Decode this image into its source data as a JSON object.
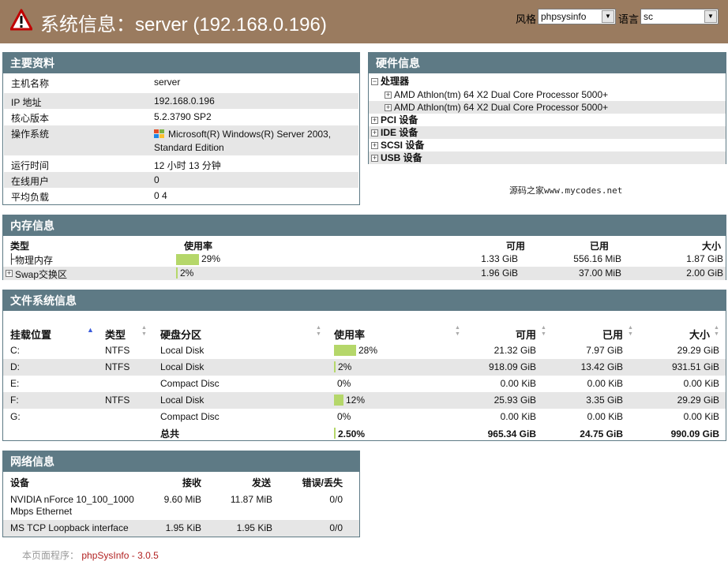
{
  "header": {
    "title": "系统信息：server (192.168.0.196)",
    "style_label": "风格",
    "style_value": "phpsysinfo",
    "lang_label": "语言",
    "lang_value": "sc"
  },
  "vitals": {
    "title": "主要资料",
    "rows": [
      {
        "label": "主机名称",
        "value": "server"
      },
      {
        "label": "IP 地址",
        "value": "192.168.0.196"
      },
      {
        "label": "核心版本",
        "value": "5.2.3790 SP2"
      },
      {
        "label": "操作系统",
        "value": "Microsoft(R) Windows(R) Server 2003,",
        "value2": "Standard Edition"
      },
      {
        "label": "运行时间",
        "value": "12 小时 13 分钟"
      },
      {
        "label": "在线用户",
        "value": "0"
      },
      {
        "label": "平均负载",
        "value": "0 4"
      }
    ]
  },
  "hardware": {
    "title": "硬件信息",
    "processor_label": "处理器",
    "cpus": [
      "AMD Athlon(tm) 64 X2 Dual Core Processor 5000+",
      "AMD Athlon(tm) 64 X2 Dual Core Processor 5000+"
    ],
    "pci_label": "PCI 设备",
    "ide_label": "IDE 设备",
    "scsi_label": "SCSI 设备",
    "usb_label": "USB 设备"
  },
  "watermark": "源码之家www.mycodes.net",
  "memory": {
    "title": "内存信息",
    "headers": {
      "type": "类型",
      "usage": "使用率",
      "free": "可用",
      "used": "已用",
      "size": "大小"
    },
    "rows": [
      {
        "type": "物理内存",
        "percent": "29%",
        "ratio": 0.29,
        "free": "1.33 GiB",
        "used": "556.16 MiB",
        "size": "1.87 GiB"
      },
      {
        "type": "Swap交换区",
        "percent": "2%",
        "ratio": 0.02,
        "free": "1.96 GiB",
        "used": "37.00 MiB",
        "size": "2.00 GiB"
      }
    ]
  },
  "filesystem": {
    "title": "文件系统信息",
    "headers": {
      "mount": "挂载位置",
      "type": "类型",
      "partition": "硬盘分区",
      "usage": "使用率",
      "free": "可用",
      "used": "已用",
      "size": "大小"
    },
    "rows": [
      {
        "mount": "C:",
        "type": "NTFS",
        "partition": "Local Disk",
        "percent": "28%",
        "ratio": 0.28,
        "free": "21.32 GiB",
        "used": "7.97 GiB",
        "size": "29.29 GiB"
      },
      {
        "mount": "D:",
        "type": "NTFS",
        "partition": "Local Disk",
        "percent": "2%",
        "ratio": 0.02,
        "free": "918.09 GiB",
        "used": "13.42 GiB",
        "size": "931.51 GiB"
      },
      {
        "mount": "E:",
        "type": "",
        "partition": "Compact Disc",
        "percent": "0%",
        "ratio": 0,
        "free": "0.00 KiB",
        "used": "0.00 KiB",
        "size": "0.00 KiB"
      },
      {
        "mount": "F:",
        "type": "NTFS",
        "partition": "Local Disk",
        "percent": "12%",
        "ratio": 0.12,
        "free": "25.93 GiB",
        "used": "3.35 GiB",
        "size": "29.29 GiB"
      },
      {
        "mount": "G:",
        "type": "",
        "partition": "Compact Disc",
        "percent": "0%",
        "ratio": 0,
        "free": "0.00 KiB",
        "used": "0.00 KiB",
        "size": "0.00 KiB"
      }
    ],
    "total": {
      "label": "总共",
      "percent": "2.50%",
      "ratio": 0.025,
      "free": "965.34 GiB",
      "used": "24.75 GiB",
      "size": "990.09 GiB"
    }
  },
  "network": {
    "title": "网络信息",
    "headers": {
      "device": "设备",
      "rx": "接收",
      "tx": "发送",
      "err": "错误/丢失"
    },
    "rows": [
      {
        "device": "NVIDIA nForce 10_100_1000",
        "device2": "Mbps Ethernet",
        "rx": "9.60 MiB",
        "tx": "11.87 MiB",
        "err": "0/0"
      },
      {
        "device": "MS TCP Loopback interface",
        "device2": "",
        "rx": "1.95 KiB",
        "tx": "1.95 KiB",
        "err": "0/0"
      }
    ]
  },
  "footer": {
    "label": "本页面程序：",
    "link": "phpSysInfo - 3.0.5"
  },
  "colors": {
    "header_bg": "#9a7b5f",
    "panel_title_bg": "#5e7a85",
    "bar": "#b5d76a",
    "shade": "#e6e6e6",
    "footer_link": "#b22222"
  }
}
